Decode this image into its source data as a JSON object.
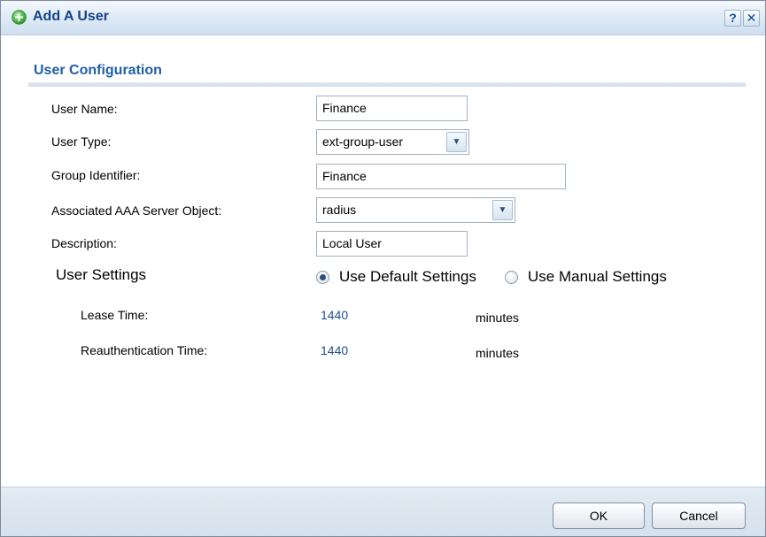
{
  "window": {
    "title": "Add A User",
    "help_label": "?",
    "close_label": "✕"
  },
  "section": {
    "title": "User Configuration"
  },
  "form": {
    "user_name": {
      "label": "User Name:",
      "value": "Finance"
    },
    "user_type": {
      "label": "User Type:",
      "value": "ext-group-user"
    },
    "group_identifier": {
      "label": "Group Identifier:",
      "value": "Finance"
    },
    "aaa_server": {
      "label": "Associated AAA Server Object:",
      "value": "radius"
    },
    "description": {
      "label": "Description:",
      "value": "Local User"
    }
  },
  "user_settings": {
    "heading": "User Settings",
    "options": [
      {
        "label": "Use Default Settings",
        "selected": true
      },
      {
        "label": "Use Manual Settings",
        "selected": false
      }
    ],
    "lease_time": {
      "label": "Lease Time:",
      "value": "1440",
      "unit": "minutes"
    },
    "reauth_time": {
      "label": "Reauthentication Time:",
      "value": "1440",
      "unit": "minutes"
    }
  },
  "footer": {
    "ok_label": "OK",
    "cancel_label": "Cancel"
  },
  "icons": {
    "title_icon": "add-circle-icon",
    "dropdown": "chevron-down-icon"
  },
  "colors": {
    "title_text": "#15428b",
    "section_title": "#1f5fa8",
    "value_link": "#1f4f8f",
    "add_icon_green": "#3aa540"
  }
}
